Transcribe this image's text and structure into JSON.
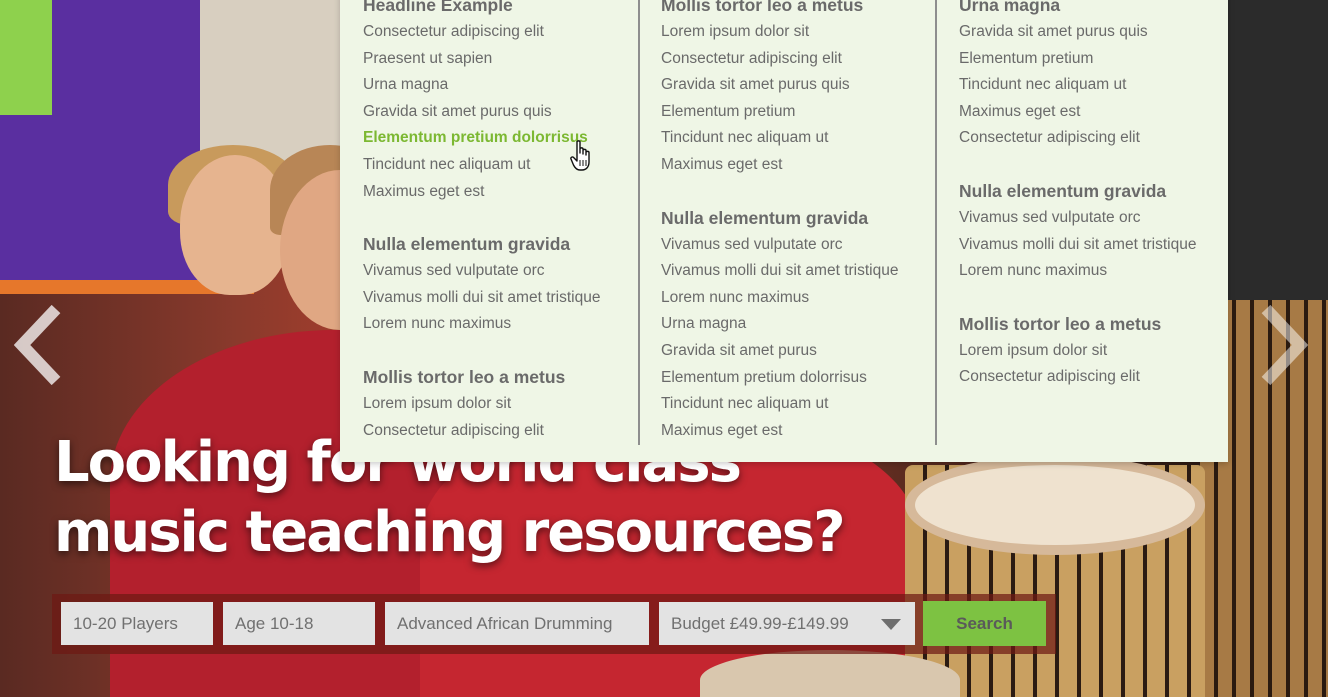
{
  "colors": {
    "accent_green": "#7dc242",
    "active_link": "#7cb832",
    "menu_bg": "#eff6e6",
    "menu_text": "#6a6a6a"
  },
  "menu": {
    "columns": [
      {
        "groups": [
          {
            "heading": "Headline Example",
            "items": [
              "Consectetur adipiscing elit",
              "Praesent ut sapien",
              "Urna magna",
              "Gravida sit amet purus quis",
              "Elementum pretium dolorrisus",
              "Tincidunt nec aliquam ut",
              "Maximus eget est"
            ]
          },
          {
            "heading": "Nulla elementum gravida",
            "items": [
              "Vivamus sed vulputate orc",
              "Vivamus molli dui sit amet tristique",
              "Lorem nunc maximus"
            ]
          },
          {
            "heading": "Mollis tortor leo a metus",
            "items": [
              "Lorem ipsum dolor sit",
              "Consectetur adipiscing elit"
            ]
          }
        ]
      },
      {
        "groups": [
          {
            "heading": "Mollis tortor leo a metus",
            "items": [
              "Lorem ipsum dolor sit",
              "Consectetur adipiscing elit",
              "Gravida sit amet purus quis",
              "Elementum pretium",
              "Tincidunt nec aliquam ut",
              "Maximus eget est"
            ]
          },
          {
            "heading": "Nulla elementum gravida",
            "items": [
              "Vivamus sed vulputate orc",
              "Vivamus molli dui sit amet tristique",
              "Lorem nunc maximus",
              "Urna magna",
              "Gravida sit amet purus",
              "Elementum pretium dolorrisus",
              "Tincidunt nec aliquam ut",
              "Maximus eget est"
            ]
          }
        ]
      },
      {
        "groups": [
          {
            "heading": "Urna magna",
            "items": [
              "Gravida sit amet purus quis",
              "Elementum pretium",
              "Tincidunt nec aliquam ut",
              "Maximus eget est",
              "Consectetur adipiscing elit"
            ]
          },
          {
            "heading": "Nulla elementum gravida",
            "items": [
              "Vivamus sed vulputate orc",
              "Vivamus molli dui sit amet tristique",
              "Lorem nunc maximus"
            ]
          },
          {
            "heading": "Mollis tortor leo a metus",
            "items": [
              "Lorem ipsum dolor sit",
              "Consectetur adipiscing elit"
            ]
          }
        ]
      }
    ],
    "hovered_item": "Elementum pretium dolorrisus"
  },
  "hero": {
    "headline_line1": "Looking for world class",
    "headline_line2": "music teaching resources?"
  },
  "carousel": {
    "prev_icon": "chevron-left-icon",
    "next_icon": "chevron-right-icon"
  },
  "search": {
    "players": "10-20 Players",
    "age": "Age 10-18",
    "topic": "Advanced African Drumming",
    "budget": "Budget £49.99-£149.99",
    "button_label": "Search",
    "dropdown_icon": "caret-down-icon"
  }
}
